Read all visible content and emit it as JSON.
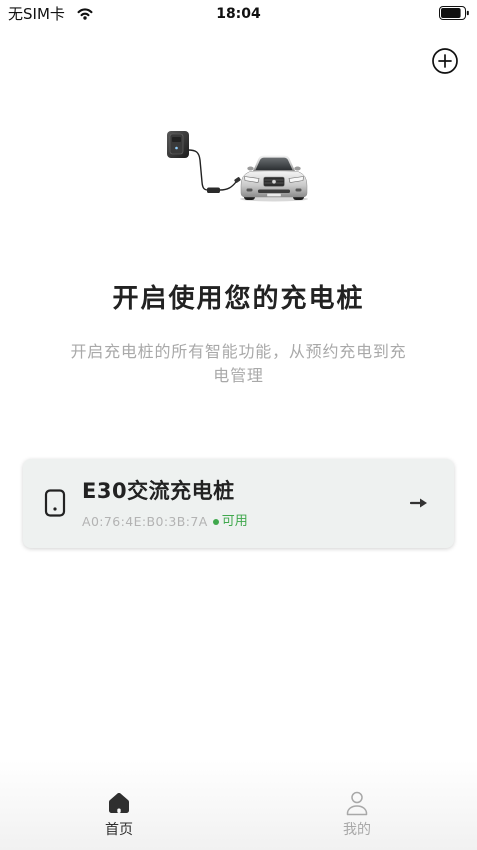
{
  "status_bar": {
    "carrier": "无SIM卡",
    "time": "18:04",
    "wifi_icon": "wifi-icon",
    "battery_icon": "battery-icon",
    "battery_level": 0.85
  },
  "header": {
    "add_icon": "add-circle-icon"
  },
  "hero": {
    "title": "开启使用您的充电桩",
    "subtitle": "开启充电桩的所有智能功能，从预约充电到充电管理"
  },
  "device_card": {
    "icon": "charger-device-icon",
    "name": "E30交流充电桩",
    "mac": "A0:76:4E:B0:3B:7A",
    "status": "可用",
    "status_color": "#3fa84c",
    "arrow_icon": "arrow-right-icon"
  },
  "tab_bar": {
    "active_color": "#2f2f2f",
    "inactive_color": "#a8a8a8",
    "tabs": [
      {
        "label": "首页",
        "icon": "home-icon",
        "active": true
      },
      {
        "label": "我的",
        "icon": "user-icon",
        "active": false
      }
    ]
  }
}
